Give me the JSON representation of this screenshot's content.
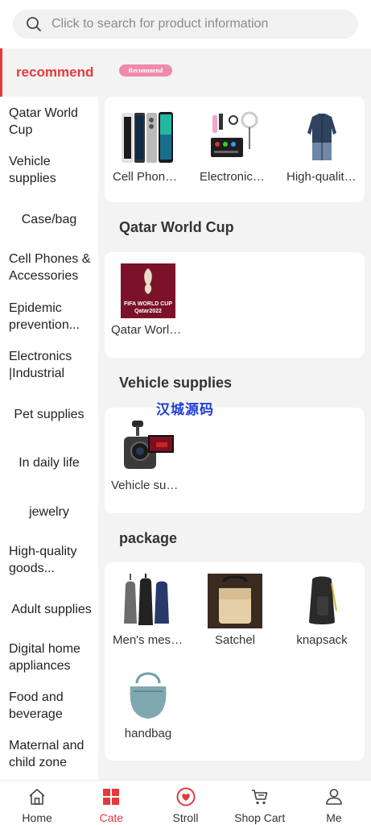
{
  "search": {
    "placeholder": "Click to search for product information"
  },
  "sidebar": {
    "items": [
      {
        "label": "recommend"
      },
      {
        "label": "Qatar World Cup"
      },
      {
        "label": "Vehicle supplies"
      },
      {
        "label": "Case/bag"
      },
      {
        "label": "Cell Phones & Accessories"
      },
      {
        "label": "Epidemic prevention..."
      },
      {
        "label": "Electronics |Industrial"
      },
      {
        "label": "Pet supplies"
      },
      {
        "label": "In daily life"
      },
      {
        "label": "jewelry"
      },
      {
        "label": "High-quality goods..."
      },
      {
        "label": "Adult supplies"
      },
      {
        "label": "Digital home appliances"
      },
      {
        "label": "Food and beverage"
      },
      {
        "label": "Maternal and child zone"
      }
    ]
  },
  "recommend": {
    "badge": "Recommend",
    "products": [
      {
        "name": "Cell Phones & Accessories"
      },
      {
        "name": "Electronics |Industrial"
      },
      {
        "name": "High-quality goods"
      }
    ]
  },
  "sections": [
    {
      "title": "Qatar World Cup",
      "products": [
        {
          "name": "Qatar World Cup"
        }
      ]
    },
    {
      "title": "Vehicle supplies",
      "products": [
        {
          "name": "Vehicle supplies"
        }
      ]
    },
    {
      "title": "package",
      "products": [
        {
          "name": "Men's messenger bag"
        },
        {
          "name": "Satchel"
        },
        {
          "name": "knapsack"
        },
        {
          "name": "handbag"
        }
      ]
    }
  ],
  "fifa_logo": {
    "line1": "FIFA WORLD CUP",
    "line2": "Qatar2022"
  },
  "watermark": "汉城源码",
  "tabbar": {
    "tabs": [
      {
        "label": "Home",
        "icon": "home-icon"
      },
      {
        "label": "Cate",
        "icon": "category-icon"
      },
      {
        "label": "Stroll",
        "icon": "heart-icon"
      },
      {
        "label": "Shop Cart",
        "icon": "cart-icon"
      },
      {
        "label": "Me",
        "icon": "user-icon"
      }
    ]
  },
  "colors": {
    "accent": "#e4393c",
    "badge": "#ee8aaa",
    "fifa": "#7b1229",
    "background": "#f3f3f3"
  }
}
